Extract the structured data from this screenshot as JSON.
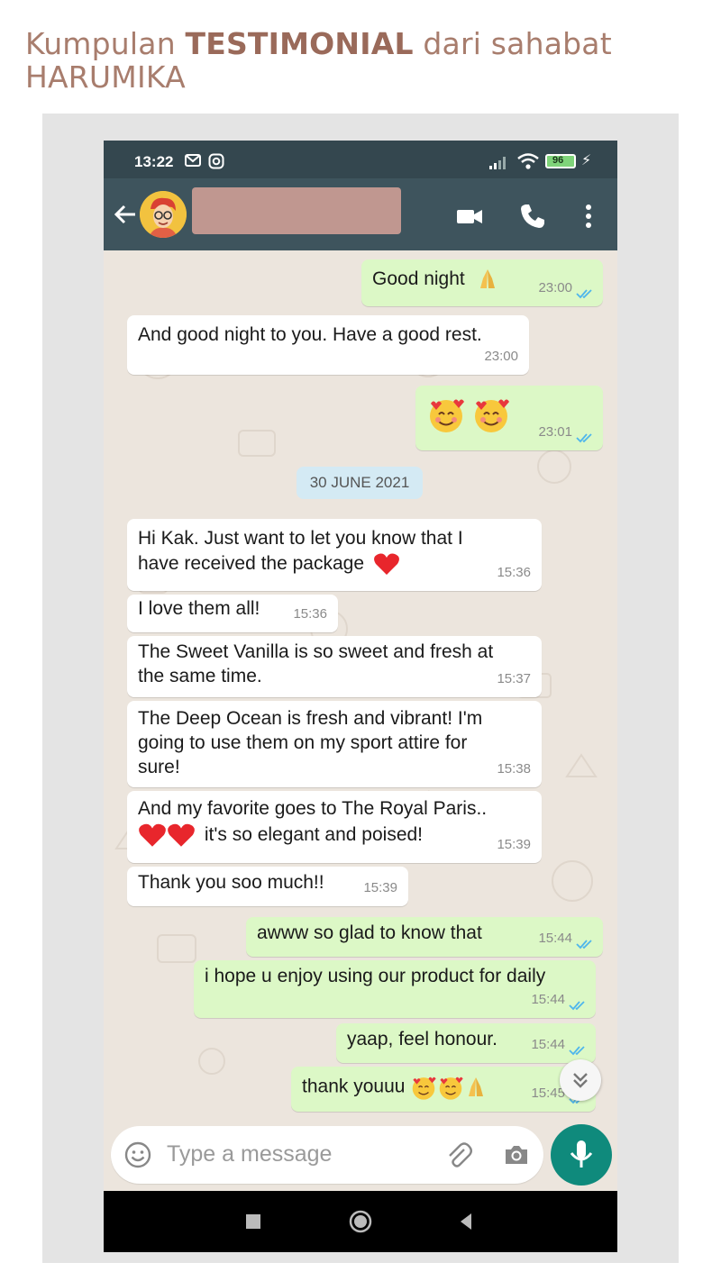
{
  "header": {
    "title_pre": "Kumpulan ",
    "title_bold": "TESTIMONIAL",
    "title_post": " dari sahabat",
    "title_line2": "HARUMIKA"
  },
  "status_bar": {
    "time": "13:22",
    "battery": "96"
  },
  "chat": {
    "date_divider": "30 JUNE 2021",
    "messages": [
      {
        "dir": "out",
        "text": "Good night",
        "time": "23:00"
      },
      {
        "dir": "in",
        "text": "And good night to you. Have a good rest.",
        "time": "23:00"
      },
      {
        "dir": "out",
        "text": "",
        "time": "23:01"
      },
      {
        "dir": "in",
        "text": "Hi Kak. Just want to let you know that I\nhave received the package",
        "time": "15:36"
      },
      {
        "dir": "in",
        "text": "I love them all!",
        "time": "15:36"
      },
      {
        "dir": "in",
        "text": "The Sweet Vanilla is so sweet and fresh at\nthe same time.",
        "time": "15:37"
      },
      {
        "dir": "in",
        "text": "The Deep Ocean is fresh and vibrant! I'm\ngoing to use them on my sport attire for\nsure!",
        "time": "15:38"
      },
      {
        "dir": "in",
        "text": "And my favorite goes to The Royal Paris..",
        "text2": "it's so elegant and poised!",
        "time": "15:39"
      },
      {
        "dir": "in",
        "text": "Thank you soo much!!",
        "time": "15:39"
      },
      {
        "dir": "out",
        "text": "awww so glad to know that",
        "time": "15:44"
      },
      {
        "dir": "out",
        "text": "i hope u enjoy using our product for daily",
        "time": "15:44"
      },
      {
        "dir": "out",
        "text": "yaap, feel honour.",
        "time": "15:44"
      },
      {
        "dir": "out",
        "text": "thank youuu",
        "time": "15:45"
      }
    ]
  },
  "composer": {
    "placeholder": "Type a message"
  },
  "colors": {
    "appbar": "#3e545d",
    "outgoing": "#dcf8c6",
    "incoming": "#ffffff",
    "accent": "#0f8a7c",
    "tick": "#4fb6ec"
  }
}
